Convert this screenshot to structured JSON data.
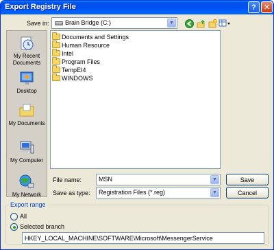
{
  "window": {
    "title": "Export Registry File"
  },
  "titlebar": {
    "help_glyph": "?",
    "close_glyph": "✕"
  },
  "save_in": {
    "label": "Save in:",
    "value": "Brain Bridge (C:)"
  },
  "toolbar": {
    "icons": [
      "back-icon",
      "up-folder-icon",
      "new-folder-icon",
      "view-menu-icon"
    ]
  },
  "places": [
    {
      "label": "My Recent Documents"
    },
    {
      "label": "Desktop"
    },
    {
      "label": "My Documents"
    },
    {
      "label": "My Computer"
    },
    {
      "label": "My Network"
    }
  ],
  "files": [
    {
      "name": "Documents and Settings"
    },
    {
      "name": "Human Resource"
    },
    {
      "name": "Intel"
    },
    {
      "name": "Program Files"
    },
    {
      "name": "TempEI4"
    },
    {
      "name": "WINDOWS"
    }
  ],
  "file_name": {
    "label": "File name:",
    "value": "MSN"
  },
  "save_as_type": {
    "label": "Save as type:",
    "value": "Registration Files (*.reg)"
  },
  "buttons": {
    "save": "Save",
    "cancel": "Cancel"
  },
  "export_range": {
    "title": "Export range",
    "all_label": "All",
    "selected_label": "Selected branch",
    "selected": "selected_branch",
    "branch_path": "HKEY_LOCAL_MACHINE\\SOFTWARE\\Microsoft\\MessengerService"
  },
  "colors": {
    "title_bar": "#0053ee",
    "window_bg": "#ece9d8",
    "close_button": "#c63a14"
  }
}
